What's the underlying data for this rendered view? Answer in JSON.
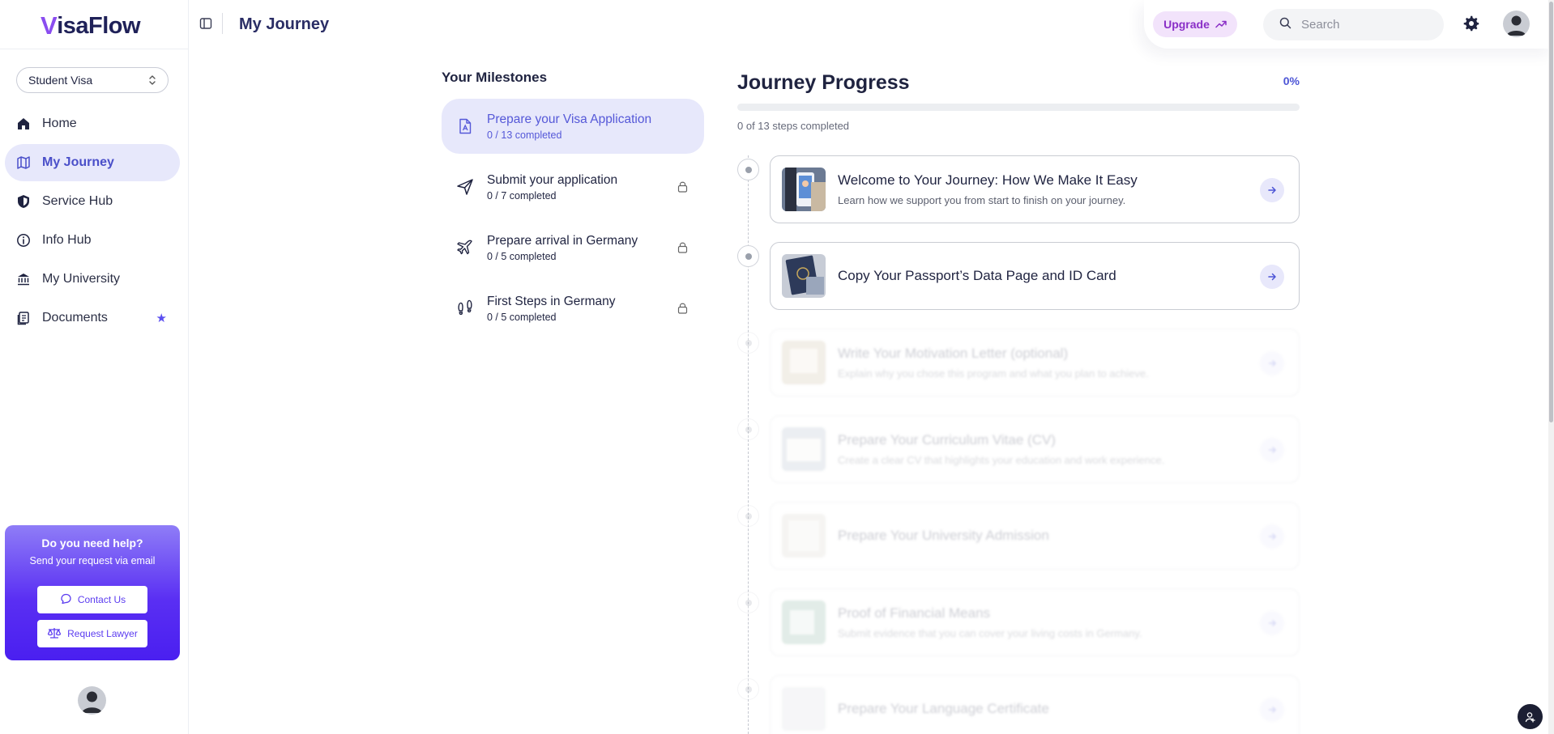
{
  "app": {
    "logo_initial": "V",
    "logo_rest": "isaFlow"
  },
  "sidebar": {
    "visa_select": "Student Visa",
    "items": [
      {
        "label": "Home",
        "icon": "home-icon",
        "active": false
      },
      {
        "label": "My Journey",
        "icon": "map-icon",
        "active": true
      },
      {
        "label": "Service Hub",
        "icon": "shield-icon",
        "active": false
      },
      {
        "label": "Info Hub",
        "icon": "info-icon",
        "active": false
      },
      {
        "label": "My University",
        "icon": "university-icon",
        "active": false
      },
      {
        "label": "Documents",
        "icon": "documents-icon",
        "active": false,
        "starred": true
      }
    ],
    "help": {
      "title": "Do you need help?",
      "subtitle": "Send your request via email",
      "contact_label": "Contact Us",
      "lawyer_label": "Request Lawyer"
    }
  },
  "header": {
    "title": "My Journey",
    "upgrade_label": "Upgrade",
    "search_placeholder": "Search"
  },
  "milestones": {
    "title": "Your Milestones",
    "items": [
      {
        "title": "Prepare your Visa Application",
        "count": "0 / 13 completed",
        "icon": "document-icon",
        "active": true,
        "locked": false
      },
      {
        "title": "Submit your application",
        "count": "0 / 7 completed",
        "icon": "send-icon",
        "active": false,
        "locked": true
      },
      {
        "title": "Prepare arrival in Germany",
        "count": "0 / 5 completed",
        "icon": "plane-icon",
        "active": false,
        "locked": true
      },
      {
        "title": "First Steps in Germany",
        "count": "0 / 5 completed",
        "icon": "footsteps-icon",
        "active": false,
        "locked": true
      }
    ]
  },
  "journey": {
    "title": "Journey Progress",
    "percent_label": "0%",
    "progress_fraction": 0,
    "steps_label": "0 of 13 steps completed",
    "steps": [
      {
        "title": "Welcome to Your Journey: How We Make It Easy",
        "desc": "Learn how we support you from start to finish on your journey.",
        "faded": false
      },
      {
        "title": "Copy Your Passport’s Data Page and ID Card",
        "desc": "",
        "faded": false
      },
      {
        "title": "Write Your Motivation Letter (optional)",
        "desc": "Explain why you chose this program and what you plan to achieve.",
        "faded": true
      },
      {
        "title": "Prepare Your Curriculum Vitae (CV)",
        "desc": "Create a clear CV that highlights your education and work experience.",
        "faded": true
      },
      {
        "title": "Prepare Your University Admission",
        "desc": "",
        "faded": true
      },
      {
        "title": "Proof of Financial Means",
        "desc": "Submit evidence that you can cover your living costs in Germany.",
        "faded": true
      },
      {
        "title": "Prepare Your Language Certificate",
        "desc": "",
        "faded": true
      }
    ]
  },
  "colors": {
    "accent": "#4d55d6",
    "active_bg": "#e7e8fb",
    "brand_purple": "#8a4df0"
  }
}
